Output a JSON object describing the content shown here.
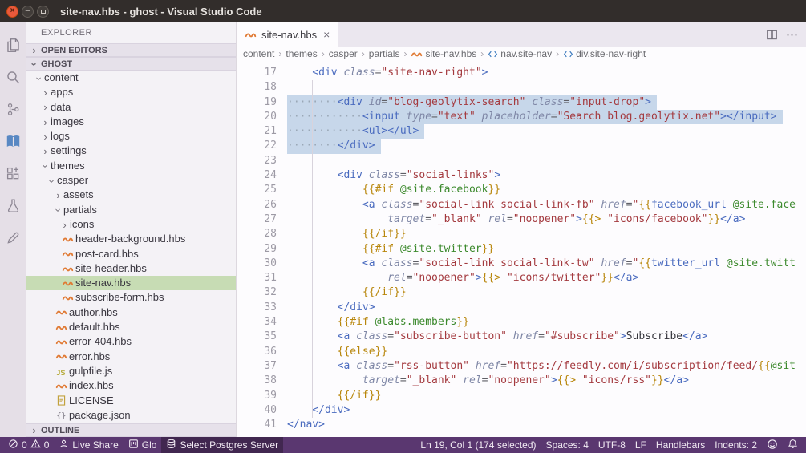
{
  "theme": {
    "status_bar": "#5a3770",
    "editor_selection": "#c7d7ea",
    "list_selection": "#c7dcb4",
    "hbs_accent": "#e07a34"
  },
  "title_bar": {
    "title": "site-nav.hbs - ghost - Visual Studio Code"
  },
  "activity_bar": {
    "items": [
      {
        "name": "explorer",
        "icon": "files-icon",
        "active": true
      },
      {
        "name": "search",
        "icon": "search-icon"
      },
      {
        "name": "source-control",
        "icon": "source-control-icon"
      },
      {
        "name": "docs",
        "icon": "book-icon"
      },
      {
        "name": "extensions",
        "icon": "extensions-icon"
      },
      {
        "name": "testing",
        "icon": "beaker-icon"
      },
      {
        "name": "edit",
        "icon": "edit-icon"
      }
    ]
  },
  "sidebar": {
    "title": "EXPLORER",
    "sections": {
      "open_editors": "OPEN EDITORS",
      "folder": "GHOST",
      "outline": "OUTLINE"
    },
    "tree": [
      {
        "label": "content",
        "depth": 0,
        "type": "folder",
        "state": "expanded"
      },
      {
        "label": "apps",
        "depth": 1,
        "type": "folder",
        "state": "collapsed"
      },
      {
        "label": "data",
        "depth": 1,
        "type": "folder",
        "state": "collapsed"
      },
      {
        "label": "images",
        "depth": 1,
        "type": "folder",
        "state": "collapsed"
      },
      {
        "label": "logs",
        "depth": 1,
        "type": "folder",
        "state": "collapsed"
      },
      {
        "label": "settings",
        "depth": 1,
        "type": "folder",
        "state": "collapsed"
      },
      {
        "label": "themes",
        "depth": 1,
        "type": "folder",
        "state": "expanded"
      },
      {
        "label": "casper",
        "depth": 2,
        "type": "folder",
        "state": "expanded"
      },
      {
        "label": "assets",
        "depth": 3,
        "type": "folder",
        "state": "collapsed"
      },
      {
        "label": "partials",
        "depth": 3,
        "type": "folder",
        "state": "expanded"
      },
      {
        "label": "icons",
        "depth": 4,
        "type": "folder",
        "state": "collapsed"
      },
      {
        "label": "header-background.hbs",
        "depth": 4,
        "type": "file",
        "icon": "hbs-icon"
      },
      {
        "label": "post-card.hbs",
        "depth": 4,
        "type": "file",
        "icon": "hbs-icon"
      },
      {
        "label": "site-header.hbs",
        "depth": 4,
        "type": "file",
        "icon": "hbs-icon"
      },
      {
        "label": "site-nav.hbs",
        "depth": 4,
        "type": "file",
        "icon": "hbs-icon",
        "selected": true
      },
      {
        "label": "subscribe-form.hbs",
        "depth": 4,
        "type": "file",
        "icon": "hbs-icon"
      },
      {
        "label": "author.hbs",
        "depth": 3,
        "type": "file",
        "icon": "hbs-icon"
      },
      {
        "label": "default.hbs",
        "depth": 3,
        "type": "file",
        "icon": "hbs-icon"
      },
      {
        "label": "error-404.hbs",
        "depth": 3,
        "type": "file",
        "icon": "hbs-icon"
      },
      {
        "label": "error.hbs",
        "depth": 3,
        "type": "file",
        "icon": "hbs-icon"
      },
      {
        "label": "gulpfile.js",
        "depth": 3,
        "type": "file",
        "icon": "js-icon"
      },
      {
        "label": "index.hbs",
        "depth": 3,
        "type": "file",
        "icon": "hbs-icon"
      },
      {
        "label": "LICENSE",
        "depth": 3,
        "type": "file",
        "icon": "license-icon"
      },
      {
        "label": "package.json",
        "depth": 3,
        "type": "file",
        "icon": "json-icon"
      }
    ]
  },
  "editor": {
    "tab": {
      "label": "site-nav.hbs",
      "icon": "hbs-icon"
    },
    "breadcrumbs": [
      {
        "label": "content"
      },
      {
        "label": "themes"
      },
      {
        "label": "casper"
      },
      {
        "label": "partials"
      },
      {
        "label": "site-nav.hbs",
        "icon": "hbs-icon"
      },
      {
        "label": "nav.site-nav",
        "icon": "symbol-element-icon"
      },
      {
        "label": "div.site-nav-right",
        "icon": "symbol-element-icon"
      }
    ],
    "lines": [
      {
        "num": 17,
        "tokens": [
          [
            "ws",
            "    "
          ],
          [
            "tag",
            "<div "
          ],
          [
            "attr",
            "class"
          ],
          [
            "pun",
            "="
          ],
          [
            "str",
            "\"site-nav-right\""
          ],
          [
            "tag",
            ">"
          ]
        ]
      },
      {
        "num": 18,
        "tokens": []
      },
      {
        "num": 19,
        "sel": true,
        "tokens": [
          [
            "wsd",
            "········"
          ],
          [
            "tag",
            "<div "
          ],
          [
            "attr",
            "id"
          ],
          [
            "pun",
            "="
          ],
          [
            "str",
            "\"blog-geolytix-search\""
          ],
          [
            "ws",
            " "
          ],
          [
            "attr",
            "class"
          ],
          [
            "pun",
            "="
          ],
          [
            "str",
            "\"input-drop\""
          ],
          [
            "tag",
            ">"
          ]
        ]
      },
      {
        "num": 20,
        "sel": true,
        "tokens": [
          [
            "wsd",
            "············"
          ],
          [
            "tag",
            "<input "
          ],
          [
            "attr",
            "type"
          ],
          [
            "pun",
            "="
          ],
          [
            "str",
            "\"text\""
          ],
          [
            "ws",
            " "
          ],
          [
            "attr",
            "placeholder"
          ],
          [
            "pun",
            "="
          ],
          [
            "str",
            "\"Search blog.geolytix.net\""
          ],
          [
            "tag",
            "></input>"
          ]
        ]
      },
      {
        "num": 21,
        "sel": true,
        "tokens": [
          [
            "wsd",
            "············"
          ],
          [
            "tag",
            "<ul></ul>"
          ]
        ]
      },
      {
        "num": 22,
        "sel": true,
        "tokens": [
          [
            "wsd",
            "········"
          ],
          [
            "tag",
            "</div>"
          ]
        ]
      },
      {
        "num": 23,
        "tokens": []
      },
      {
        "num": 24,
        "tokens": [
          [
            "ws",
            "        "
          ],
          [
            "tag",
            "<div "
          ],
          [
            "attr",
            "class"
          ],
          [
            "pun",
            "="
          ],
          [
            "str",
            "\"social-links\""
          ],
          [
            "tag",
            ">"
          ]
        ]
      },
      {
        "num": 25,
        "tokens": [
          [
            "ws",
            "            "
          ],
          [
            "hbs",
            "{{#if "
          ],
          [
            "var",
            "@site.facebook"
          ],
          [
            "hbs",
            "}}"
          ]
        ]
      },
      {
        "num": 26,
        "tokens": [
          [
            "ws",
            "            "
          ],
          [
            "tag",
            "<a "
          ],
          [
            "attr",
            "class"
          ],
          [
            "pun",
            "="
          ],
          [
            "str",
            "\"social-link social-link-fb\""
          ],
          [
            "ws",
            " "
          ],
          [
            "attr",
            "href"
          ],
          [
            "pun",
            "="
          ],
          [
            "str",
            "\""
          ],
          [
            "hbs",
            "{{"
          ],
          [
            "helper",
            "facebook_url "
          ],
          [
            "var",
            "@site.face"
          ]
        ]
      },
      {
        "num": 27,
        "tokens": [
          [
            "ws",
            "                "
          ],
          [
            "attr",
            "target"
          ],
          [
            "pun",
            "="
          ],
          [
            "str",
            "\"_blank\""
          ],
          [
            "ws",
            " "
          ],
          [
            "attr",
            "rel"
          ],
          [
            "pun",
            "="
          ],
          [
            "str",
            "\"noopener\""
          ],
          [
            "tag",
            ">"
          ],
          [
            "hbs",
            "{{> "
          ],
          [
            "str",
            "\"icons/facebook\""
          ],
          [
            "hbs",
            "}}"
          ],
          [
            "tag",
            "</a>"
          ]
        ]
      },
      {
        "num": 28,
        "tokens": [
          [
            "ws",
            "            "
          ],
          [
            "hbs",
            "{{/if}}"
          ]
        ]
      },
      {
        "num": 29,
        "tokens": [
          [
            "ws",
            "            "
          ],
          [
            "hbs",
            "{{#if "
          ],
          [
            "var",
            "@site.twitter"
          ],
          [
            "hbs",
            "}}"
          ]
        ]
      },
      {
        "num": 30,
        "tokens": [
          [
            "ws",
            "            "
          ],
          [
            "tag",
            "<a "
          ],
          [
            "attr",
            "class"
          ],
          [
            "pun",
            "="
          ],
          [
            "str",
            "\"social-link social-link-tw\""
          ],
          [
            "ws",
            " "
          ],
          [
            "attr",
            "href"
          ],
          [
            "pun",
            "="
          ],
          [
            "str",
            "\""
          ],
          [
            "hbs",
            "{{"
          ],
          [
            "helper",
            "twitter_url "
          ],
          [
            "var",
            "@site.twitt"
          ]
        ]
      },
      {
        "num": 31,
        "tokens": [
          [
            "ws",
            "                "
          ],
          [
            "attr",
            "rel"
          ],
          [
            "pun",
            "="
          ],
          [
            "str",
            "\"noopener\""
          ],
          [
            "tag",
            ">"
          ],
          [
            "hbs",
            "{{> "
          ],
          [
            "str",
            "\"icons/twitter\""
          ],
          [
            "hbs",
            "}}"
          ],
          [
            "tag",
            "</a>"
          ]
        ]
      },
      {
        "num": 32,
        "tokens": [
          [
            "ws",
            "            "
          ],
          [
            "hbs",
            "{{/if}}"
          ]
        ]
      },
      {
        "num": 33,
        "tokens": [
          [
            "ws",
            "        "
          ],
          [
            "tag",
            "</div>"
          ]
        ]
      },
      {
        "num": 34,
        "tokens": [
          [
            "ws",
            "        "
          ],
          [
            "hbs",
            "{{#if "
          ],
          [
            "var",
            "@labs.members"
          ],
          [
            "hbs",
            "}}"
          ]
        ]
      },
      {
        "num": 35,
        "tokens": [
          [
            "ws",
            "        "
          ],
          [
            "tag",
            "<a "
          ],
          [
            "attr",
            "class"
          ],
          [
            "pun",
            "="
          ],
          [
            "str",
            "\"subscribe-button\""
          ],
          [
            "ws",
            " "
          ],
          [
            "attr",
            "href"
          ],
          [
            "pun",
            "="
          ],
          [
            "str",
            "\"#subscribe\""
          ],
          [
            "tag",
            ">"
          ],
          [
            "text",
            "Subscribe"
          ],
          [
            "tag",
            "</a>"
          ]
        ]
      },
      {
        "num": 36,
        "tokens": [
          [
            "ws",
            "        "
          ],
          [
            "hbs",
            "{{else}}"
          ]
        ]
      },
      {
        "num": 37,
        "tokens": [
          [
            "ws",
            "        "
          ],
          [
            "tag",
            "<a "
          ],
          [
            "attr",
            "class"
          ],
          [
            "pun",
            "="
          ],
          [
            "str",
            "\"rss-button\""
          ],
          [
            "ws",
            " "
          ],
          [
            "attr",
            "href"
          ],
          [
            "pun",
            "="
          ],
          [
            "str",
            "\""
          ],
          [
            "link",
            "https://feedly.com/i/subscription/feed/"
          ],
          [
            "hbsu",
            "{{"
          ],
          [
            "varu",
            "@sit"
          ]
        ]
      },
      {
        "num": 38,
        "tokens": [
          [
            "ws",
            "            "
          ],
          [
            "attr",
            "target"
          ],
          [
            "pun",
            "="
          ],
          [
            "str",
            "\"_blank\""
          ],
          [
            "ws",
            " "
          ],
          [
            "attr",
            "rel"
          ],
          [
            "pun",
            "="
          ],
          [
            "str",
            "\"noopener\""
          ],
          [
            "tag",
            ">"
          ],
          [
            "hbs",
            "{{> "
          ],
          [
            "str",
            "\"icons/rss\""
          ],
          [
            "hbs",
            "}}"
          ],
          [
            "tag",
            "</a>"
          ]
        ]
      },
      {
        "num": 39,
        "tokens": [
          [
            "ws",
            "        "
          ],
          [
            "hbs",
            "{{/if}}"
          ]
        ]
      },
      {
        "num": 40,
        "tokens": [
          [
            "ws",
            "    "
          ],
          [
            "tag",
            "</div>"
          ]
        ]
      },
      {
        "num": 41,
        "tokens": [
          [
            "tag",
            "</nav>"
          ]
        ]
      }
    ]
  },
  "status_bar": {
    "left": [
      {
        "name": "problems",
        "error_count": "0",
        "warning_count": "0"
      },
      {
        "name": "live-share",
        "label": "Live Share",
        "icon": "live-share-icon"
      },
      {
        "name": "glo",
        "label": "Glo",
        "icon": "glo-icon"
      },
      {
        "name": "postgres-server",
        "label": "Select Postgres Server",
        "icon": "database-icon",
        "prominent": true
      }
    ],
    "right": [
      {
        "name": "cursor-position",
        "label": "Ln 19, Col 1 (174 selected)"
      },
      {
        "name": "indentation",
        "label": "Spaces: 4"
      },
      {
        "name": "encoding",
        "label": "UTF-8"
      },
      {
        "name": "eol",
        "label": "LF"
      },
      {
        "name": "language-mode",
        "label": "Handlebars"
      },
      {
        "name": "indents",
        "label": "Indents: 2"
      },
      {
        "name": "feedback",
        "icon": "smiley-icon"
      },
      {
        "name": "notifications",
        "icon": "bell-icon"
      }
    ]
  }
}
